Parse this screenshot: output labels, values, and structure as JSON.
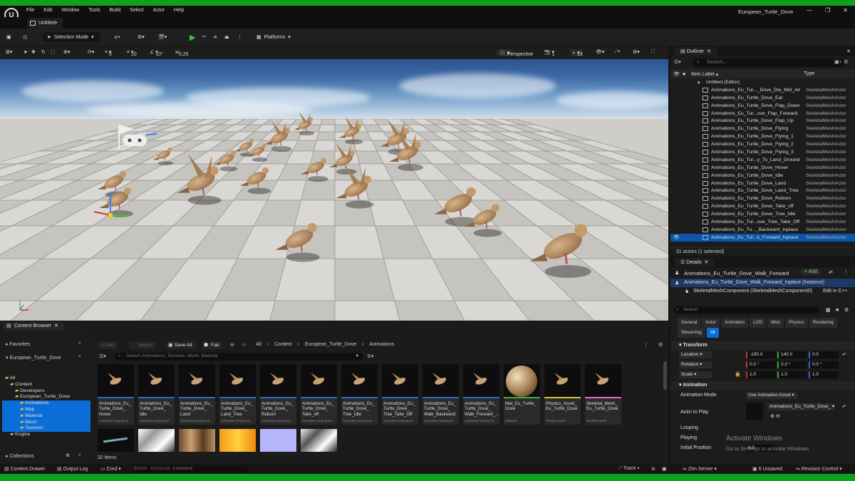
{
  "app": {
    "window_title": "European_Turtle_Dove",
    "menu": [
      "File",
      "Edit",
      "Window",
      "Tools",
      "Build",
      "Select",
      "Actor",
      "Help"
    ],
    "doc_tab": "Untitled•"
  },
  "toolbar": {
    "selection_mode": "Selection Mode",
    "platforms": "Platforms"
  },
  "viewport": {
    "snap_rotation": "0",
    "grid_size": "10",
    "rotation_snap": "10°",
    "scale_snap": "0.25",
    "perspective": "Perspective",
    "camera_speed": "1",
    "lit": "Lit"
  },
  "outliner": {
    "title": "Outliner",
    "search_placeholder": "Search...",
    "col_label": "Item Label ▴",
    "col_type": "Type",
    "root": "Untitled (Editor)",
    "items": [
      {
        "name": "Animations_Eu_Tur..._Dove_Die_Mid_Air",
        "type": "SkeletalMeshActor"
      },
      {
        "name": "Animations_Eu_Turtle_Dove_Eat",
        "type": "SkeletalMeshActor"
      },
      {
        "name": "Animations_Eu_Turtle_Dove_Flap_Down",
        "type": "SkeletalMeshActor"
      },
      {
        "name": "Animations_Eu_Tur...ove_Flap_Forward",
        "type": "SkeletalMeshActor"
      },
      {
        "name": "Animations_Eu_Turtle_Dove_Flap_Up",
        "type": "SkeletalMeshActor"
      },
      {
        "name": "Animations_Eu_Turtle_Dove_Flying",
        "type": "SkeletalMeshActor"
      },
      {
        "name": "Animations_Eu_Turtle_Dove_Flying_1",
        "type": "SkeletalMeshActor"
      },
      {
        "name": "Animations_Eu_Turtle_Dove_Flying_2",
        "type": "SkeletalMeshActor"
      },
      {
        "name": "Animations_Eu_Turtle_Dove_Flying_3",
        "type": "SkeletalMeshActor"
      },
      {
        "name": "Animations_Eu_Tur...y_To_Land_Ground",
        "type": "SkeletalMeshActor"
      },
      {
        "name": "Animations_Eu_Turtle_Dove_Hover",
        "type": "SkeletalMeshActor"
      },
      {
        "name": "Animations_Eu_Turtle_Dove_Idle",
        "type": "SkeletalMeshActor"
      },
      {
        "name": "Animations_Eu_Turtle_Dove_Land",
        "type": "SkeletalMeshActor"
      },
      {
        "name": "Animations_Eu_Turtle_Dove_Land_Tree",
        "type": "SkeletalMeshActor"
      },
      {
        "name": "Animations_Eu_Turtle_Dove_Reborn",
        "type": "SkeletalMeshActor"
      },
      {
        "name": "Animations_Eu_Turtle_Dove_Take_off",
        "type": "SkeletalMeshActor"
      },
      {
        "name": "Animations_Eu_Turtle_Dove_Tree_Idle",
        "type": "SkeletalMeshActor"
      },
      {
        "name": "Animations_Eu_Tur...ove_Tree_Take_Off",
        "type": "SkeletalMeshActor"
      },
      {
        "name": "Animations_Eu_Tu..._Backward_Inplace",
        "type": "SkeletalMeshActor"
      },
      {
        "name": "Animations_Eu_Tur...k_Forward_Inplace",
        "type": "SkeletalMeshActor"
      }
    ],
    "footer": "31 actors (1 selected)"
  },
  "details": {
    "title": "Details",
    "actor_name": "Animations_Eu_Turtle_Dove_Walk_Forward",
    "add_label": "+ Add",
    "instance": "Animations_Eu_Turtle_Dove_Walk_Forward_Inplace (Instance)",
    "component": "SkeletalMeshComponent (SkeletalMeshComponent0)",
    "edit_cpp": "Edit in C++",
    "search_placeholder": "Search",
    "filters": [
      "General",
      "Actor",
      "Animation",
      "LOD",
      "Misc",
      "Physics",
      "Rendering",
      "Streaming",
      "All"
    ],
    "transform": {
      "section": "Transform",
      "location_label": "Location",
      "rotation_label": "Rotation",
      "scale_label": "Scale",
      "location": [
        "-190.0",
        "140.0",
        "0.0"
      ],
      "rotation": [
        "0.0 °",
        "0.0 °",
        "0.0 °"
      ],
      "scale": [
        "1.0",
        "1.0",
        "1.0"
      ]
    },
    "animation": {
      "section": "Animation",
      "mode_label": "Animation Mode",
      "mode_value": "Use Animation Asset",
      "anim_label": "Anim to Play",
      "anim_value": "Animations_Eu_Turtle_Dove_",
      "looping": "Looping",
      "playing": "Playing",
      "initial_pos": "Initial Position",
      "initial_pos_value": "0.0"
    }
  },
  "content_browser": {
    "tab": "Content Browser",
    "favorites": "Favorites",
    "project": "European_Turtle_Dove",
    "tree": [
      {
        "label": "All",
        "level": 0,
        "selected": false
      },
      {
        "label": "Content",
        "level": 1,
        "selected": false
      },
      {
        "label": "Developers",
        "level": 2,
        "selected": false
      },
      {
        "label": "European_Turtle_Dove",
        "level": 2,
        "selected": false
      },
      {
        "label": "Animations",
        "level": 3,
        "selected": true
      },
      {
        "label": "Map",
        "level": 3,
        "selected": true
      },
      {
        "label": "Material",
        "level": 3,
        "selected": true
      },
      {
        "label": "Mesh",
        "level": 3,
        "selected": true
      },
      {
        "label": "Textures",
        "level": 3,
        "selected": true
      },
      {
        "label": "Engine",
        "level": 1,
        "selected": false
      }
    ],
    "collections": "Collections",
    "add": "+ Add",
    "import": "Import",
    "save_all": "Save All",
    "fab": "Fab",
    "path": [
      "All",
      "Content",
      "European_Turtle_Dove",
      "Animations"
    ],
    "search_placeholder": "Search Animations, Textures, Mesh, Material",
    "items_count": "32 items",
    "assets": [
      {
        "name": "Animations_Eu_\nTurtle_Dove_\nHover",
        "type": "Animation Sequence"
      },
      {
        "name": "Animations_Eu_\nTurtle_Dove_\nIdle",
        "type": "Animation Sequence"
      },
      {
        "name": "Animations_Eu_\nTurtle_Dove_\nLand",
        "type": "Animation Sequence"
      },
      {
        "name": "Animations_Eu_\nTurtle_Dove_\nLand_Tree",
        "type": "Animation Sequence"
      },
      {
        "name": "Animations_Eu_\nTurtle_Dove_\nReborn",
        "type": "Animation Sequence"
      },
      {
        "name": "Animations_Eu_\nTurtle_Dove_\nTake_off",
        "type": "Animation Sequence"
      },
      {
        "name": "Animations_Eu_\nTurtle_Dove_\nTree_Idle",
        "type": "Animation Sequence"
      },
      {
        "name": "Animations_Eu_\nTurtle_Dove_\nTree_Take_Off",
        "type": "Animation Sequence"
      },
      {
        "name": "Animations_Eu_\nTurtle_Dove_\nWalk_Backward",
        "type": "Animation Sequence"
      },
      {
        "name": "Animations_Eu_\nTurtle_Dove_\nWalk_Forward_...",
        "type": "Animation Sequence"
      },
      {
        "name": "Mat_Eu_Turtle_\nDove",
        "type": "Material"
      },
      {
        "name": "Physics_Asset_\nEu_Turtle_Dove",
        "type": "Physics Asset"
      },
      {
        "name": "Skeletal_Mesh_\nEu_Turtle_Dove",
        "type": "Skeletal Mesh"
      }
    ]
  },
  "statusbar": {
    "content_drawer": "Content Drawer",
    "output_log": "Output Log",
    "cmd": "Cmd",
    "console_placeholder": "Enter Console Command",
    "trace": "Trace",
    "zen_server": "Zen Server",
    "unsaved": "6 Unsaved",
    "revision": "Revision Control"
  },
  "watermark": {
    "line1": "Activate Windows",
    "line2": "Go to Settings to activate Windows."
  }
}
